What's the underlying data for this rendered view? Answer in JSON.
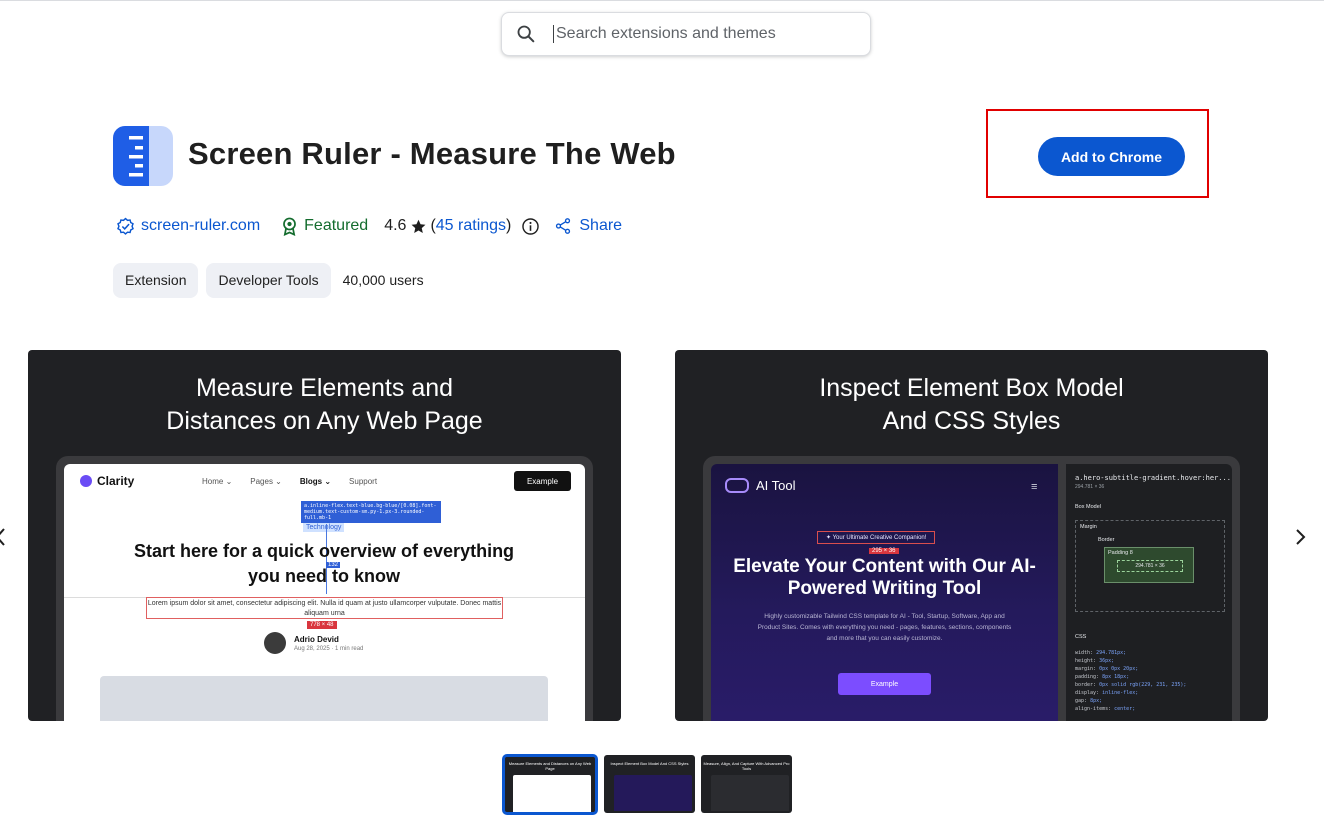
{
  "search": {
    "placeholder": "Search extensions and themes"
  },
  "extension": {
    "title": "Screen Ruler - Measure The Web",
    "add_button": "Add to Chrome",
    "site": "screen-ruler.com",
    "featured": "Featured",
    "rating_value": "4.6",
    "rating_open": "(",
    "ratings_link": "45 ratings",
    "rating_close": ")",
    "share": "Share",
    "chips": [
      "Extension",
      "Developer Tools"
    ],
    "users": "40,000 users"
  },
  "colors": {
    "accent": "#0b57d0",
    "featured_green": "#146c2e",
    "highlight_red": "#e10000",
    "slide_bg": "#202124"
  },
  "slides": [
    {
      "heading": "Measure Elements and\nDistances on Any Web Page",
      "mock": {
        "brand": "Clarity",
        "nav": [
          "Home ⌄",
          "Pages ⌄",
          "Blogs ⌄",
          "Support"
        ],
        "example": "Example",
        "tooltip": "a.inline-flex.text-blue.bg-blue/[0.08].font-medium.text-custom-sm.py-1.px-3.rounded-full.mb-1",
        "tag": "Technology",
        "measure": "132",
        "headline": "Start here for a quick overview of everything you need to know",
        "lorem": "Lorem ipsum dolor sit amet, consectetur adipiscing elit. Nulla id quam at justo ullamcorper vulputate. Donec mattis aliquam urna",
        "size_badge": "778 × 48",
        "author": "Adrio Devid",
        "date": "Aug 28, 2025 · 1 min read"
      }
    },
    {
      "heading": "Inspect Element Box Model\nAnd CSS Styles",
      "mock": {
        "brand": "AI Tool",
        "menu": "≡",
        "pill": "✦ Your Ultimate Creative Companion!",
        "size_badge": "295 × 36",
        "headline": "Elevate Your Content with Our AI-Powered Writing Tool",
        "sub": "Highly customizable Tailwind CSS template for AI - Tool, Startup, Software, App and Product Sites. Comes with everything you need - pages, features, sections, components and more that you can easily customize.",
        "button": "Example",
        "selector": "a.hero-subtitle-gradient.hover:her...",
        "dims": "294.781 × 36",
        "box_model": "Box Model",
        "margin": "Margin",
        "border": "Border",
        "padding": "Padding  8",
        "content": "294.781 × 36",
        "css": "CSS",
        "code": [
          [
            "width:",
            "294.781px;"
          ],
          [
            "height:",
            "36px;"
          ],
          [
            "margin:",
            "0px 0px 20px;"
          ],
          [
            "padding:",
            "8px 18px;"
          ],
          [
            "border:",
            "0px solid rgb(229, 231, 235);"
          ],
          [
            "display:",
            "inline-flex;"
          ],
          [
            "gap:",
            "8px;"
          ],
          [
            "align-items:",
            "center;"
          ]
        ]
      }
    }
  ],
  "thumbnails": [
    {
      "title": "Measure Elements and Distances on Any Web Page"
    },
    {
      "title": "Inspect Element Box Model And CSS Styles"
    },
    {
      "title": "Measure, Align, And Capture With Advanced Pro Tools"
    }
  ]
}
